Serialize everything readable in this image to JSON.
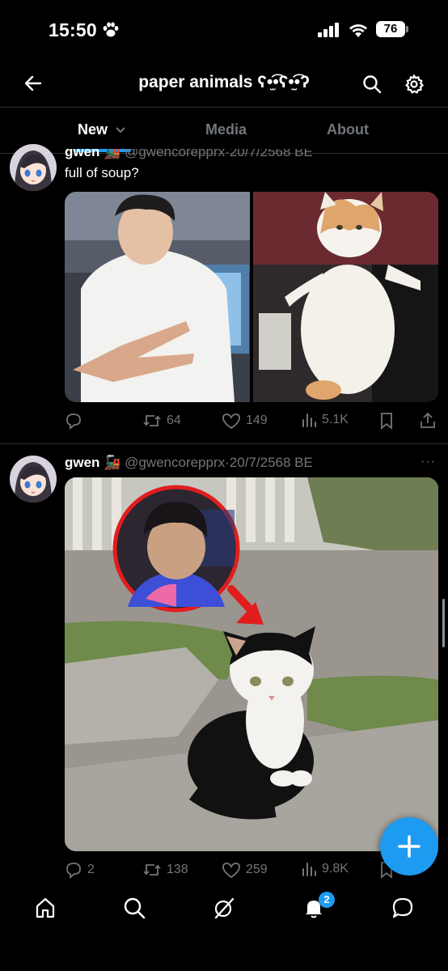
{
  "status_bar": {
    "time": "15:50",
    "battery": "76"
  },
  "header": {
    "title": "paper animals ʕ•̫͡•ʕ•̫͡•ʔ"
  },
  "tabs": [
    {
      "label": "New",
      "active": true
    },
    {
      "label": "Media",
      "active": false
    },
    {
      "label": "About",
      "active": false
    }
  ],
  "posts": [
    {
      "name": "gwen",
      "handle": "@gwencorepprx",
      "date": "20/7/2568 BE",
      "text": "full of soup?",
      "media_alt": [
        "young man in white t-shirt making peace sign",
        "cream and orange cat standing on hind legs"
      ],
      "stats": {
        "replies": "",
        "reposts": "64",
        "likes": "149",
        "views": "5.1K"
      }
    },
    {
      "name": "gwen",
      "handle": "@gwencorepprx",
      "date": "20/7/2568 BE",
      "text": "",
      "media_alt": [
        "circled photo of young man with red arrow pointing to black and white kitten"
      ],
      "stats": {
        "replies": "2",
        "reposts": "138",
        "likes": "259",
        "views": "9.8K"
      }
    }
  ],
  "nav": {
    "notifications_badge": "2"
  },
  "colors": {
    "accent": "#1d9bf0",
    "background": "#000000",
    "muted": "#71767b"
  }
}
